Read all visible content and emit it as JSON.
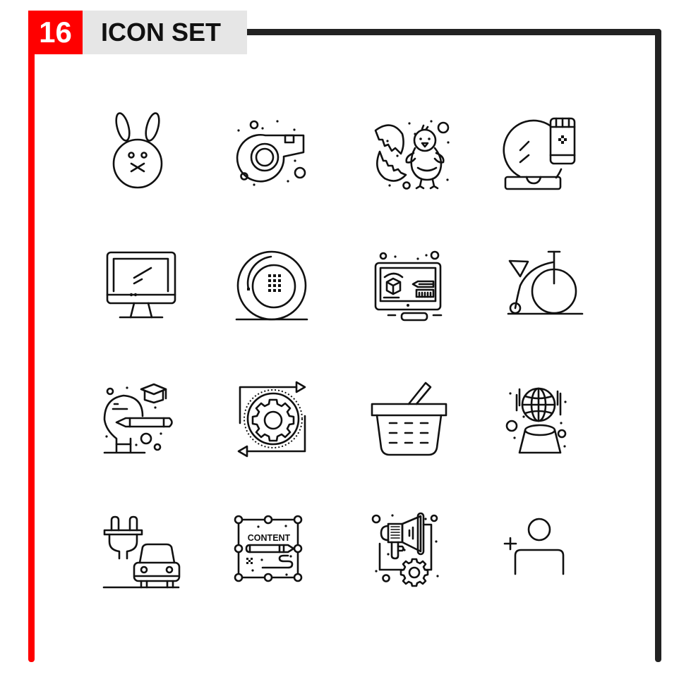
{
  "header": {
    "number": "16",
    "title": "ICON SET"
  },
  "colors": {
    "accent": "#ff0000",
    "frame": "#222222",
    "title_bg": "#e6e6e6",
    "icon_stroke": "#111111"
  },
  "icons": [
    {
      "name": "rabbit-face-icon"
    },
    {
      "name": "whistle-icon"
    },
    {
      "name": "hatching-chick-icon"
    },
    {
      "name": "crystal-ball-bottle-icon"
    },
    {
      "name": "computer-monitor-icon"
    },
    {
      "name": "wheel-tire-icon"
    },
    {
      "name": "3d-design-monitor-icon"
    },
    {
      "name": "penny-farthing-bicycle-icon"
    },
    {
      "name": "education-idea-bulb-icon"
    },
    {
      "name": "gear-process-cycle-icon"
    },
    {
      "name": "shopping-basket-icon"
    },
    {
      "name": "globe-hologram-icon"
    },
    {
      "name": "electric-car-charging-icon"
    },
    {
      "name": "content-design-icon",
      "label": "CONTENT"
    },
    {
      "name": "megaphone-gear-marketing-icon"
    },
    {
      "name": "add-user-icon"
    }
  ]
}
